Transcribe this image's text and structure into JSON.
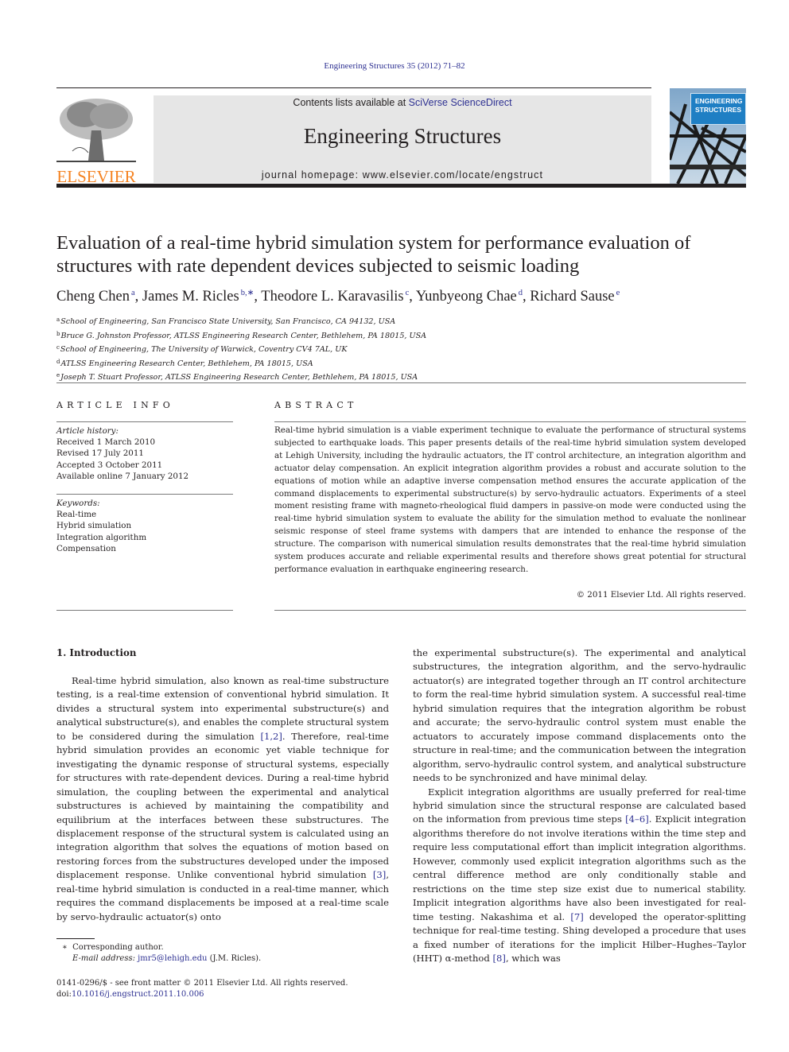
{
  "header": {
    "journal_citation": "Engineering Structures 35 (2012) 71–82",
    "contents_prefix": "Contents lists available at ",
    "contents_link": "SciVerse ScienceDirect",
    "journal_title": "Engineering Structures",
    "homepage_prefix": "journal homepage: ",
    "homepage_url": "www.elsevier.com/locate/engstruct",
    "publisher_logo_text": "ELSEVIER",
    "cover_title_line1": "ENGINEERING",
    "cover_title_line2": "STRUCTURES"
  },
  "article": {
    "title": "Evaluation of a real-time hybrid simulation system for performance evaluation of structures with rate dependent devices subjected to seismic loading",
    "authors": [
      {
        "name": "Cheng Chen",
        "sup": "a"
      },
      {
        "name": "James M. Ricles",
        "sup": "b,∗"
      },
      {
        "name": "Theodore L. Karavasilis",
        "sup": "c"
      },
      {
        "name": "Yunbyeong Chae",
        "sup": "d"
      },
      {
        "name": "Richard Sause",
        "sup": "e"
      }
    ],
    "affiliations": [
      {
        "key": "a",
        "text": "School of Engineering, San Francisco State University, San Francisco, CA 94132, USA"
      },
      {
        "key": "b",
        "text": "Bruce G. Johnston Professor, ATLSS Engineering Research Center, Bethlehem, PA 18015, USA"
      },
      {
        "key": "c",
        "text": "School of Engineering, The University of Warwick, Coventry CV4 7AL, UK"
      },
      {
        "key": "d",
        "text": "ATLSS Engineering Research Center, Bethlehem, PA 18015, USA"
      },
      {
        "key": "e",
        "text": "Joseph T. Stuart Professor, ATLSS Engineering Research Center, Bethlehem, PA 18015, USA"
      }
    ]
  },
  "article_info": {
    "heading": "ARTICLE INFO",
    "history_label": "Article history:",
    "history": [
      "Received 1 March 2010",
      "Revised 17 July 2011",
      "Accepted 3 October 2011",
      "Available online 7 January 2012"
    ],
    "keywords_label": "Keywords:",
    "keywords": [
      "Real-time",
      "Hybrid simulation",
      "Integration algorithm",
      "Compensation"
    ]
  },
  "abstract": {
    "heading": "ABSTRACT",
    "text": "Real-time hybrid simulation is a viable experiment technique to evaluate the performance of structural systems subjected to earthquake loads. This paper presents details of the real-time hybrid simulation system developed at Lehigh University, including the hydraulic actuators, the IT control architecture, an integration algorithm and actuator delay compensation. An explicit integration algorithm provides a robust and accurate solution to the equations of motion while an adaptive inverse compensation method ensures the accurate application of the command displacements to experimental substructure(s) by servo-hydraulic actuators. Experiments of a steel moment resisting frame with magneto-rheological fluid dampers in passive-on mode were conducted using the real-time hybrid simulation system to evaluate the ability for the simulation method to evaluate the nonlinear seismic response of steel frame systems with dampers that are intended to enhance the response of the structure. The comparison with numerical simulation results demonstrates that the real-time hybrid simulation system produces accurate and reliable experimental results and therefore shows great potential for structural performance evaluation in earthquake engineering research.",
    "copyright": "© 2011 Elsevier Ltd. All rights reserved."
  },
  "intro": {
    "heading": "1. Introduction",
    "left_p1_a": "Real-time hybrid simulation, also known as real-time substructure testing, is a real-time extension of conventional hybrid simulation. It divides a structural system into experimental substructure(s) and analytical substructure(s), and enables the complete structural system to be considered during the simulation ",
    "ref_1_2": "[1,2]",
    "left_p1_b": ". Therefore, real-time hybrid simulation provides an economic yet viable technique for investigating the dynamic response of structural systems, especially for structures with rate-dependent devices. During a real-time hybrid simulation, the coupling between the experimental and analytical substructures is achieved by maintaining the compatibility and equilibrium at the interfaces between these substructures. The displacement response of the structural system is calculated using an integration algorithm that solves the equations of motion based on restoring forces from the substructures developed under the imposed displacement response. Unlike conventional hybrid simulation ",
    "ref_3": "[3]",
    "left_p1_c": ", real-time hybrid simulation is conducted in a real-time manner, which requires the command displacements be imposed at a real-time scale by servo-hydraulic actuator(s) onto",
    "right_p1": "the experimental substructure(s). The experimental and analytical substructures, the integration algorithm, and the servo-hydraulic actuator(s) are integrated together through an IT control architecture to form the real-time hybrid simulation system. A successful real-time hybrid simulation requires that the integration algorithm be robust and accurate; the servo-hydraulic control system must enable the actuators to accurately impose command displacements onto the structure in real-time; and the communication between the integration algorithm, servo-hydraulic control system, and analytical substructure needs to be synchronized and have minimal delay.",
    "right_p2_a": "Explicit integration algorithms are usually preferred for real-time hybrid simulation since the structural response are calculated based on the information from previous time steps ",
    "ref_4_6": "[4–6]",
    "right_p2_b": ". Explicit integration algorithms therefore do not involve iterations within the time step and require less computational effort than implicit integration algorithms. However, commonly used explicit integration algorithms such as the central difference method are only conditionally stable and restrictions on the time step size exist due to numerical stability. Implicit integration algorithms have also been investigated for real-time testing. Nakashima et al. ",
    "ref_7": "[7]",
    "right_p2_c": " developed the operator-splitting technique for real-time testing. Shing developed a procedure that uses a fixed number of iterations for the implicit Hilber–Hughes–Taylor (HHT) α-method ",
    "ref_8": "[8]",
    "right_p2_d": ", which was"
  },
  "footnotes": {
    "corresponding_mark": "∗",
    "corresponding": "Corresponding author.",
    "email_label": "E-mail address: ",
    "email": "jmr5@lehigh.edu",
    "email_suffix": " (J.M. Ricles).",
    "issn": "0141-0296/$ - see front matter © 2011 Elsevier Ltd. All rights reserved.",
    "doi_label": "doi:",
    "doi": "10.1016/j.engstruct.2011.10.006"
  },
  "colors": {
    "link": "#2e3192",
    "elsevier_orange": "#f58220",
    "masthead_bg": "#e6e6e6",
    "cover_blue": "#1f7fc4"
  }
}
